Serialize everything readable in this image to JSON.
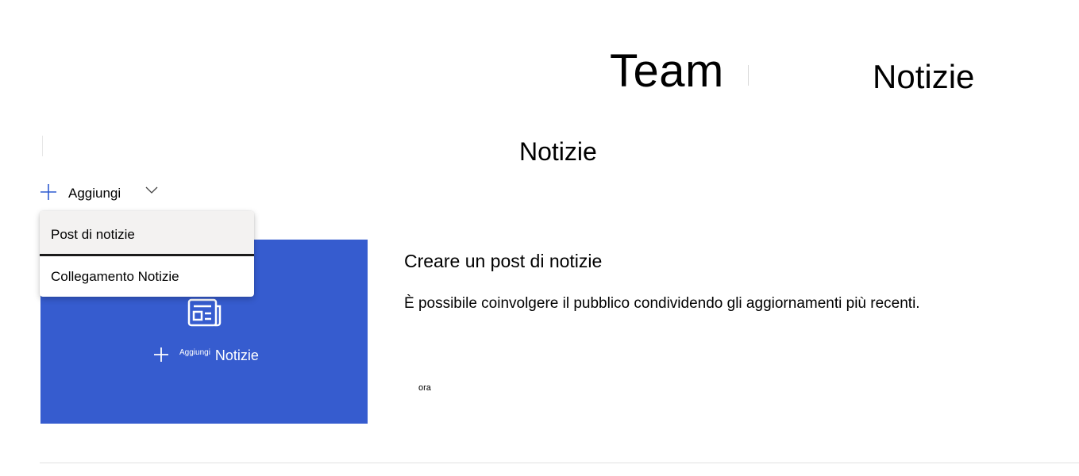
{
  "header": {
    "site_title": "Team",
    "page_title": "Notizie"
  },
  "section": {
    "title": "Notizie"
  },
  "add_button": {
    "label": "Aggiungi"
  },
  "menu": {
    "items": [
      {
        "label": "Post di notizie"
      },
      {
        "label": "Collegamento Notizie"
      }
    ]
  },
  "card": {
    "add_small_label": "Aggiungi",
    "add_label": "Notizie",
    "colors": {
      "background": "#365ccf",
      "foreground": "#ffffff"
    }
  },
  "content": {
    "heading": "Creare un post di notizie",
    "description": "È possibile coinvolgere il pubblico condividendo gli aggiornamenti più recenti.",
    "time_label": "ora"
  },
  "icons": {
    "add": "plus-icon",
    "dropdown": "chevron-down-icon",
    "news": "newspaper-icon"
  },
  "colors": {
    "accent": "#365ccf",
    "menu_hover": "#f3f2f1"
  }
}
